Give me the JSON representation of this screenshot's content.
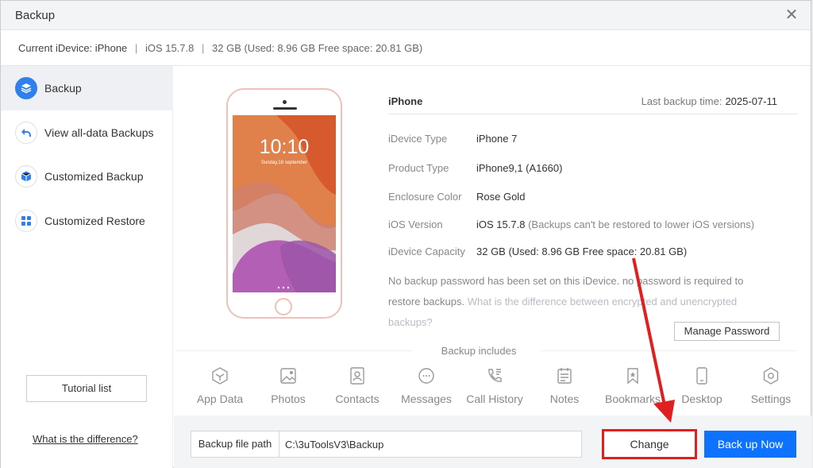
{
  "window": {
    "title": "Backup",
    "close_glyph": "✕"
  },
  "infobar": {
    "device_label": "Current iDevice: iPhone",
    "ios": "iOS 15.7.8",
    "storage": "32 GB (Used: 8.96 GB Free space: 20.81 GB)",
    "separator": "|"
  },
  "sidebar": {
    "items": [
      {
        "label": "Backup",
        "icon": "layers-icon",
        "active": true
      },
      {
        "label": "View all-data Backups",
        "icon": "undo-arrow-icon",
        "active": false
      },
      {
        "label": "Customized Backup",
        "icon": "cube-icon",
        "active": false
      },
      {
        "label": "Customized Restore",
        "icon": "grid-icon",
        "active": false
      }
    ],
    "tutorial_label": "Tutorial list",
    "difference_link": "What is the difference?"
  },
  "phone_preview": {
    "time": "10:10",
    "date": "Sunday,18 september"
  },
  "device_info": {
    "name": "iPhone",
    "last_backup_label": "Last backup time:",
    "last_backup_value": "2025-07-11",
    "rows": [
      {
        "key": "iDevice Type",
        "value": "iPhone 7"
      },
      {
        "key": "Product Type",
        "value": "iPhone9,1 (A1660)"
      },
      {
        "key": "Enclosure Color",
        "value": "Rose Gold"
      },
      {
        "key": "iOS Version",
        "value": "iOS 15.7.8",
        "note": "(Backups can't be restored to lower iOS versions)"
      },
      {
        "key": "iDevice Capacity",
        "value": "32 GB (Used: 8.96 GB  Free space: 20.81 GB)"
      }
    ],
    "password_note": "No backup password has been set on this iDevice. no password is required to restore backups.",
    "password_link": "What is the difference between encrypted and unencrypted backups?",
    "manage_password_label": "Manage Password"
  },
  "backup_includes": {
    "label": "Backup includes",
    "items": [
      {
        "label": "App Data",
        "icon": "app-data-icon"
      },
      {
        "label": "Photos",
        "icon": "photos-icon"
      },
      {
        "label": "Contacts",
        "icon": "contacts-icon"
      },
      {
        "label": "Messages",
        "icon": "messages-icon"
      },
      {
        "label": "Call History",
        "icon": "call-history-icon"
      },
      {
        "label": "Notes",
        "icon": "notes-icon"
      },
      {
        "label": "Bookmarks",
        "icon": "bookmarks-icon"
      },
      {
        "label": "Desktop",
        "icon": "desktop-icon"
      },
      {
        "label": "Settings",
        "icon": "settings-icon"
      }
    ]
  },
  "bottom": {
    "path_label": "Backup file path",
    "path_value": "C:\\3uToolsV3\\Backup",
    "change_label": "Change",
    "backup_now_label": "Back up Now"
  },
  "colors": {
    "accent": "#0d73ff",
    "annotation": "#e02020",
    "phone_frame": "#f0c0b9"
  }
}
